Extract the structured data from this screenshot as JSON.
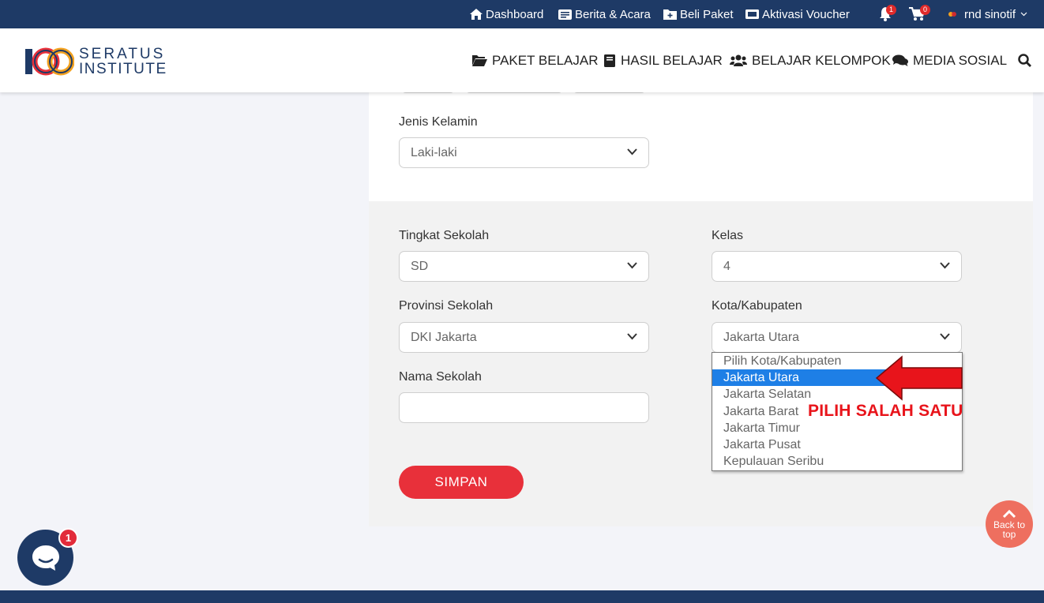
{
  "topbar": {
    "dashboard": "Dashboard",
    "berita": "Berita & Acara",
    "beli": "Beli Paket",
    "voucher": "Aktivasi Voucher",
    "notif_count": "1",
    "cart_count": "0",
    "user": "rnd sinotif"
  },
  "header": {
    "logo_line1": "SERATUS",
    "logo_line2": "INSTITUTE",
    "nav": {
      "paket": "PAKET BELAJAR",
      "hasil": "HASIL BELAJAR",
      "kelompok": "BELAJAR KELOMPOK",
      "media": "MEDIA SOSIAL"
    }
  },
  "form": {
    "gender_label": "Jenis Kelamin",
    "gender_value": "Laki-laki",
    "tingkat_label": "Tingkat Sekolah",
    "tingkat_value": "SD",
    "kelas_label": "Kelas",
    "kelas_value": "4",
    "provinsi_label": "Provinsi Sekolah",
    "provinsi_value": "DKI Jakarta",
    "kota_label": "Kota/Kabupaten",
    "kota_value": "Jakarta Utara",
    "nama_label": "Nama Sekolah",
    "nama_value": "",
    "save_label": "SIMPAN"
  },
  "kota_options": [
    "Pilih Kota/Kabupaten",
    "Jakarta Utara",
    "Jakarta Selatan",
    "Jakarta Barat",
    "Jakarta Timur",
    "Jakarta Pusat",
    "Kepulauan Seribu"
  ],
  "kota_selected_index": 1,
  "annotation": "PILIH SALAH SATU",
  "back_to_top": {
    "line1": "Back to",
    "line2": "top"
  },
  "chat_badge": "1",
  "colors": {
    "navy": "#1e3a66",
    "accent_red": "#e8303a",
    "highlight_blue": "#1e7fe6",
    "annotation_red": "#e8141b",
    "back_top": "#ee6f5f"
  },
  "icons": [
    "home-icon",
    "newspaper-icon",
    "folder-plus-icon",
    "ticket-icon",
    "bell-icon",
    "cart-icon",
    "user-dot-icon",
    "chevron-down-icon",
    "folder-open-icon",
    "book-icon",
    "users-icon",
    "comments-icon",
    "search-icon",
    "chevron-up-icon",
    "chat-bubble-icon",
    "arrow-left-icon"
  ]
}
